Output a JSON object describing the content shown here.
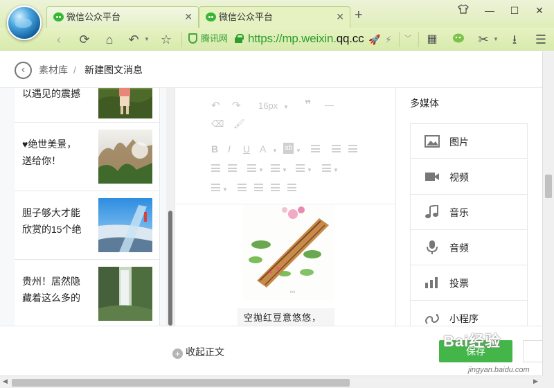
{
  "browser": {
    "tabs": [
      {
        "title": "微信公众平台",
        "active": false
      },
      {
        "title": "微信公众平台",
        "active": true
      }
    ],
    "new_tab": "+",
    "address": {
      "site_label": "腾讯网",
      "scheme": "https://",
      "domain_prefix": "mp.weixin.",
      "domain_main": "qq.cc"
    },
    "accent_color": "#2e9d2e"
  },
  "breadcrumb": {
    "items": [
      "素材库",
      "新建图文消息"
    ],
    "separator": "/"
  },
  "articles": [
    {
      "title": "以遇见的震撼",
      "thumb": "woman-hiking-photo"
    },
    {
      "title": "♥绝世美景，送给你！",
      "thumb": "misty-mountain-photo"
    },
    {
      "title": "胆子够大才能欣赏的15个绝",
      "thumb": "glass-bridge-photo"
    },
    {
      "title": "贵州！居然隐藏着这么多的",
      "thumb": "waterfall-photo"
    }
  ],
  "editor": {
    "font_size": "16px",
    "caption": "空抛红豆意悠悠，"
  },
  "media": {
    "title": "多媒体",
    "items": [
      {
        "label": "图片",
        "icon": "image-icon"
      },
      {
        "label": "视频",
        "icon": "video-icon"
      },
      {
        "label": "音乐",
        "icon": "music-icon"
      },
      {
        "label": "音频",
        "icon": "microphone-icon"
      },
      {
        "label": "投票",
        "icon": "vote-chart-icon"
      },
      {
        "label": "小程序",
        "icon": "mini-program-icon"
      }
    ]
  },
  "footer": {
    "collapse_label": "收起正文",
    "save_label": "保存",
    "primary_color": "#44b549"
  },
  "watermark": {
    "text": "Bai经验",
    "url": "jingyan.baidu.com"
  }
}
